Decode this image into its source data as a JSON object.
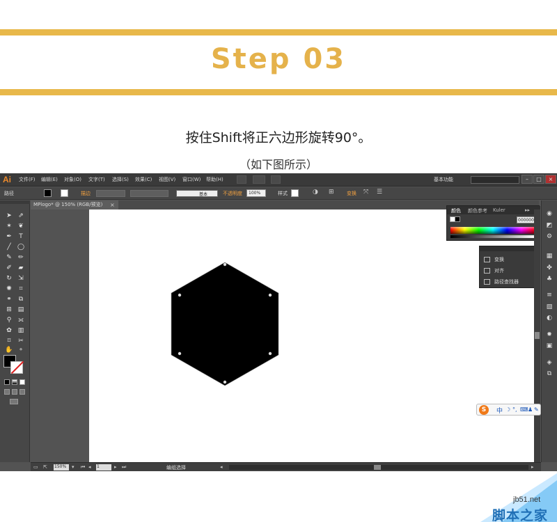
{
  "header": {
    "title": "Step 03",
    "instruction": "按住Shift将正六边形旋转90°。",
    "caption": "（如下图所示）"
  },
  "colors": {
    "accent_band": "#e8b84a",
    "title_color": "#e5b24b",
    "app_chrome": "#535353",
    "logo_orange": "#ec8a2c",
    "shape_fill": "#000000"
  },
  "app": {
    "logo": "Ai",
    "menus": [
      "文件(F)",
      "编辑(E)",
      "对象(O)",
      "文字(T)",
      "选择(S)",
      "效果(C)",
      "视图(V)",
      "窗口(W)",
      "帮助(H)"
    ],
    "workspace": "基本功能",
    "window_buttons": [
      "–",
      "□",
      "×"
    ]
  },
  "controlbar": {
    "selection_label": "路径",
    "stroke_label": "描边",
    "brush_label": "基本",
    "opacity_label": "不透明度",
    "opacity_value": "100%",
    "style_label": "样式",
    "transform_label": "变换"
  },
  "document": {
    "tab": "MPlogo* @ 150% (RGB/预览)",
    "tab_close": "×"
  },
  "color_panel": {
    "tabs": [
      "颜色",
      "颜色参考",
      "Kuler"
    ],
    "hex": "000000"
  },
  "flyout": {
    "items": [
      "变换",
      "对齐",
      "路径查找器"
    ]
  },
  "ime": {
    "logo": "S",
    "lang": "中"
  },
  "statusbar": {
    "zoom": "150%",
    "page": "1",
    "status": "编组选择"
  },
  "watermark": {
    "url": "jb51.net",
    "brand": "脚本之家"
  },
  "tools": {
    "icons": [
      "selection-tool-icon",
      "direct-selection-tool-icon",
      "magic-wand-tool-icon",
      "lasso-tool-icon",
      "pen-tool-icon",
      "type-tool-icon",
      "line-tool-icon",
      "ellipse-tool-icon",
      "paintbrush-tool-icon",
      "pencil-tool-icon",
      "blob-brush-tool-icon",
      "eraser-tool-icon",
      "rotate-tool-icon",
      "scale-tool-icon",
      "warp-tool-icon",
      "free-transform-tool-icon",
      "shape-builder-tool-icon",
      "perspective-tool-icon",
      "mesh-tool-icon",
      "gradient-tool-icon",
      "eyedropper-tool-icon",
      "blend-tool-icon",
      "symbol-sprayer-tool-icon",
      "graph-tool-icon",
      "artboard-tool-icon",
      "slice-tool-icon",
      "hand-tool-icon",
      "zoom-tool-icon"
    ]
  }
}
